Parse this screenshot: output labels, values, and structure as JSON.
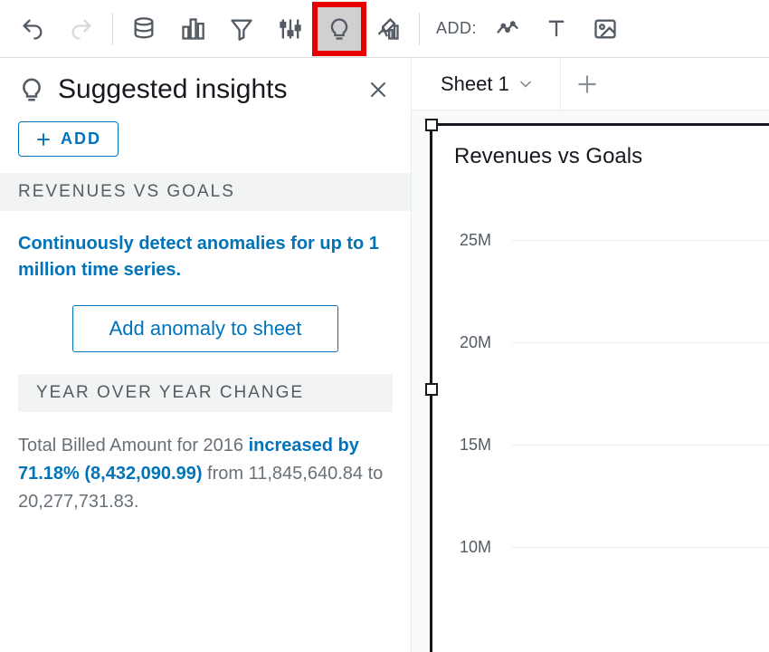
{
  "toolbar": {
    "add_label": "ADD:"
  },
  "sidebar": {
    "title": "Suggested insights",
    "add_button": "ADD",
    "sections": {
      "anomaly": {
        "header": "REVENUES VS GOALS",
        "text": "Continuously detect anomalies for up to 1 million time series.",
        "button": "Add anomaly to sheet"
      },
      "yoy": {
        "header": "YEAR OVER YEAR CHANGE",
        "prefix": "Total Billed Amount for 2016 ",
        "highlight": "increased by 71.18% (8,432,090.99)",
        "suffix": " from 11,845,640.84 to 20,277,731.83."
      }
    }
  },
  "tabs": {
    "sheet1": "Sheet 1"
  },
  "chart": {
    "title": "Revenues vs Goals"
  },
  "chart_data": {
    "type": "bar",
    "title": "Revenues vs Goals",
    "xlabel": "",
    "ylabel": "",
    "ylim": [
      0,
      25000000
    ],
    "y_ticks": [
      "25M",
      "20M",
      "15M",
      "10M"
    ],
    "categories": [],
    "values": []
  }
}
